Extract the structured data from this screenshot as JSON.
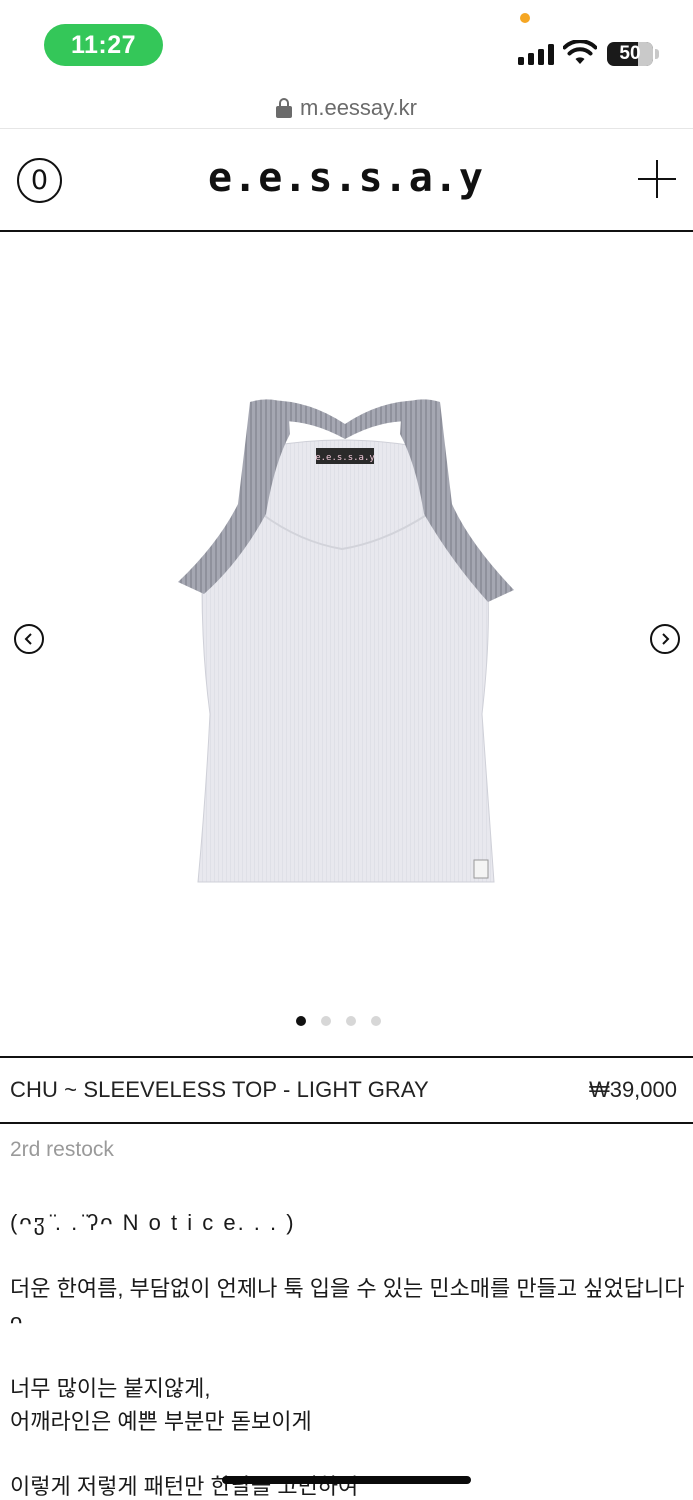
{
  "status_bar": {
    "time": "11:27",
    "battery": "50"
  },
  "browser": {
    "url": "m.eessay.kr"
  },
  "header": {
    "cart_count": "0",
    "logo": "e.e.s.s.a.y"
  },
  "gallery": {
    "image_label": "e.e.s.s.a.y",
    "image_count": 4,
    "active_index": 0
  },
  "product": {
    "name": "CHU ~ SLEEVELESS TOP - LIGHT GRAY",
    "price": "₩39,000",
    "subtitle": "2rd restock"
  },
  "description": {
    "notice": "(ᴖჳ ̈. . ̈ʔᴖ N o t i c e. . . )",
    "para1": "더운 한여름, 부담없이 언제나 툭 입을 수 있는 민소매를 만들고 싶었답니다 ᴖ",
    "para2_line1": "너무 많이는 붙지않게,",
    "para2_line2": "어깨라인은 예쁜 부분만 돋보이게",
    "para3": "이렇게 저렇게 패턴만 한달을 고민하여"
  },
  "colors": {
    "status_green": "#34c759",
    "accent": "#111111",
    "muted_text": "#9a9a9a"
  }
}
